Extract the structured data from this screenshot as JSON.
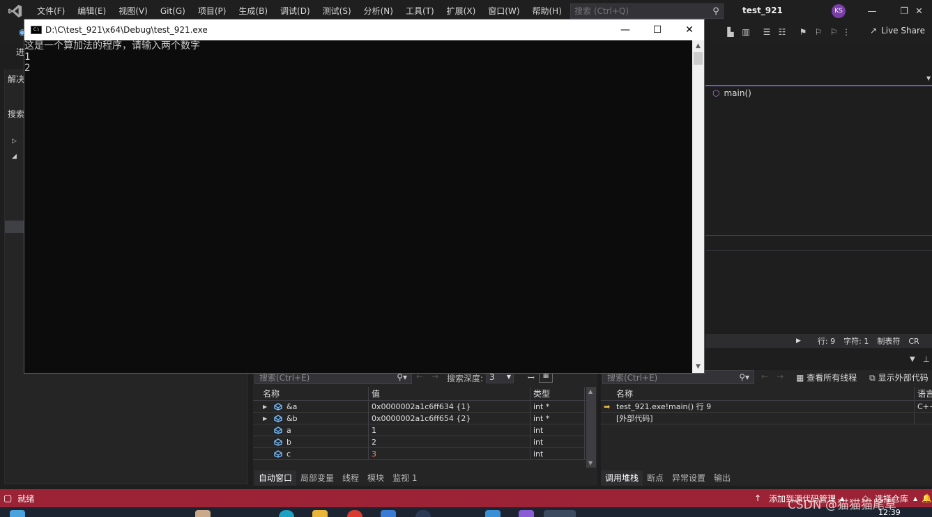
{
  "menubar": {
    "items": [
      "文件(F)",
      "编辑(E)",
      "视图(V)",
      "Git(G)",
      "项目(P)",
      "生成(B)",
      "调试(D)",
      "测试(S)",
      "分析(N)",
      "工具(T)",
      "扩展(X)",
      "窗口(W)",
      "帮助(H)"
    ],
    "search_placeholder": "搜索 (Ctrl+Q)",
    "solution_name": "test_921",
    "avatar_initials": "KS"
  },
  "toolbar": {
    "live_share": "Live Share"
  },
  "left_panel": {
    "title_partial": "解决",
    "search_partial": "搜索",
    "progress_partial": "进"
  },
  "editor": {
    "nav_function": "main()",
    "status": {
      "line": "行: 9",
      "char": "字符: 1",
      "tabs": "制表符",
      "eol": "CR"
    }
  },
  "console": {
    "title": "D:\\C\\test_921\\x64\\Debug\\test_921.exe",
    "icon_label": "C:\\",
    "lines": [
      "这是一个算加法的程序，请输入两个数字",
      "1",
      "2"
    ]
  },
  "autos": {
    "search_placeholder": "搜索(Ctrl+E)",
    "depth_label": "搜索深度:",
    "depth_value": "3",
    "headers": {
      "name": "名称",
      "value": "值",
      "type": "类型"
    },
    "rows": [
      {
        "name": "&a",
        "value": "0x0000002a1c6ff634 {1}",
        "type": "int *",
        "expandable": true
      },
      {
        "name": "&b",
        "value": "0x0000002a1c6ff654 {2}",
        "type": "int *",
        "expandable": true
      },
      {
        "name": "a",
        "value": "1",
        "type": "int",
        "expandable": false
      },
      {
        "name": "b",
        "value": "2",
        "type": "int",
        "expandable": false
      },
      {
        "name": "c",
        "value": "3",
        "type": "int",
        "expandable": false,
        "changed": true
      }
    ],
    "tabs": [
      "自动窗口",
      "局部变量",
      "线程",
      "模块",
      "监视 1"
    ]
  },
  "callstack": {
    "search_placeholder": "搜索(Ctrl+E)",
    "view_all_threads": "查看所有线程",
    "show_external": "显示外部代码",
    "headers": {
      "name": "名称",
      "lang": "语言"
    },
    "rows": [
      {
        "name": "test_921.exe!main() 行 9",
        "lang": "C++",
        "current": true
      },
      {
        "name": "[外部代码]",
        "lang": "",
        "current": false
      }
    ],
    "tabs": [
      "调用堆栈",
      "断点",
      "异常设置",
      "输出"
    ]
  },
  "statusbar": {
    "ready": "就绪",
    "source_control": "添加到源代码管理",
    "repo": "选择仓库"
  },
  "taskbar": {
    "time": "12:39"
  },
  "watermark": "CSDN @猫猫猫尾草",
  "colors": {
    "status_bar": "#9b2335",
    "accent": "#6a5acd",
    "changed_value": "#f48771"
  }
}
